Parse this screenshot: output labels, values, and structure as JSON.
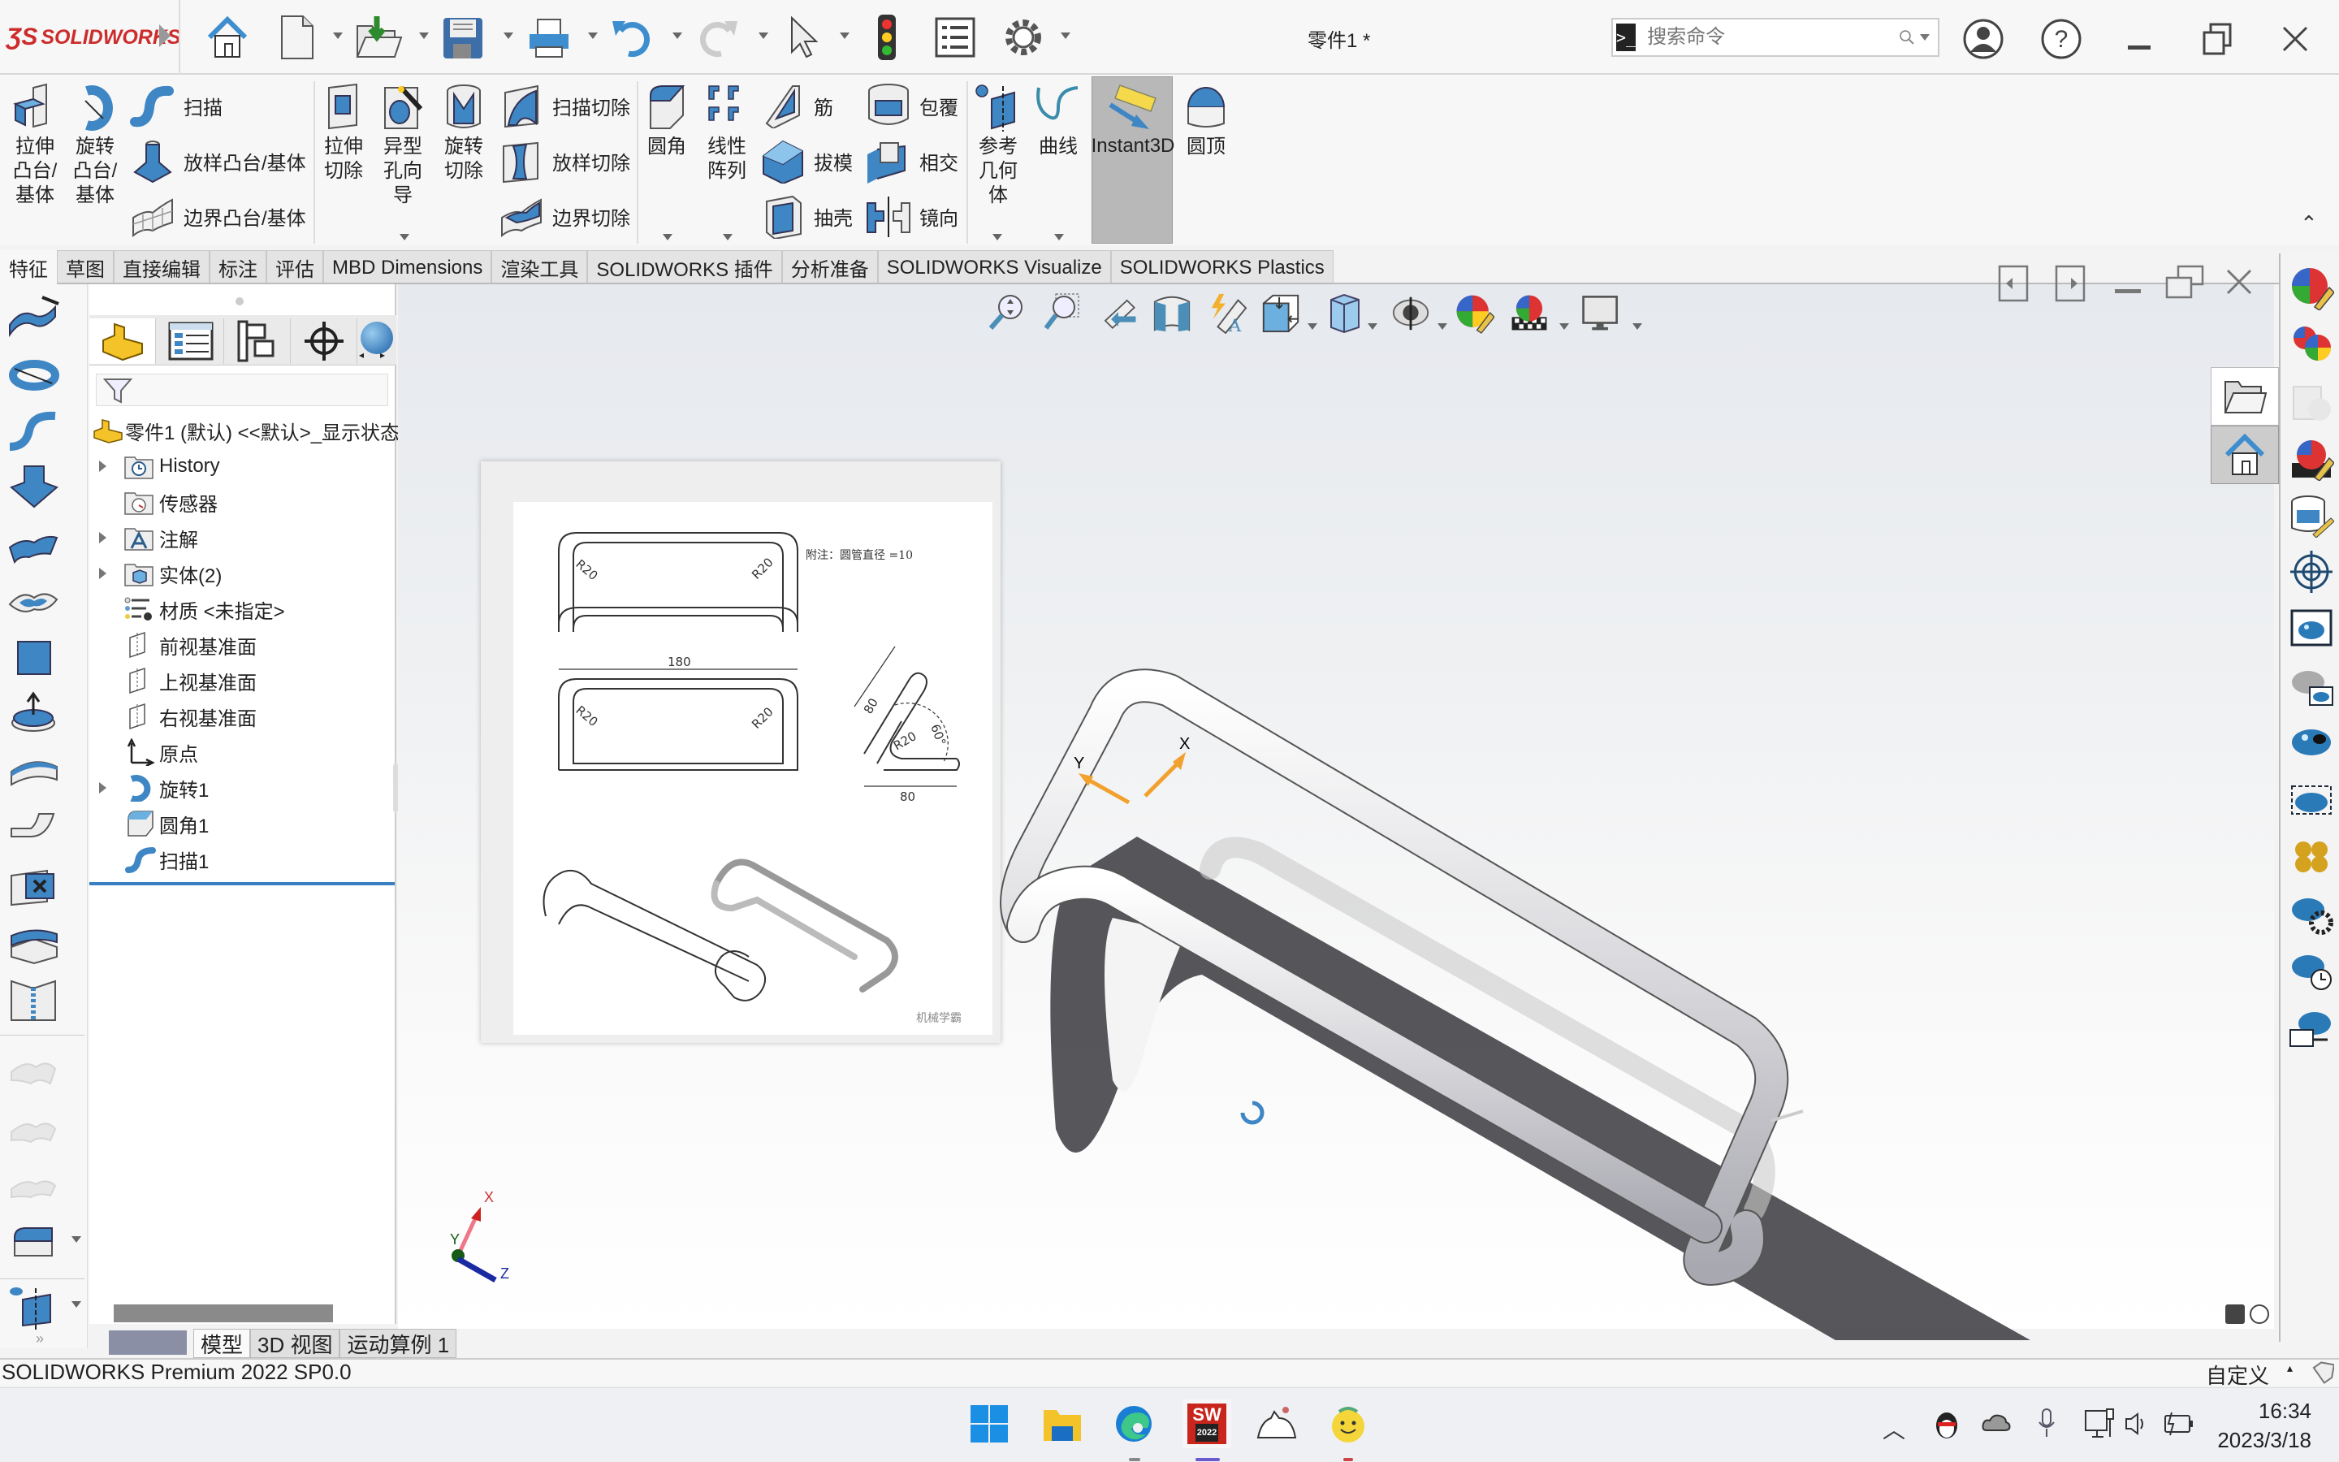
{
  "app": {
    "brand": "SOLIDWORKS",
    "document_title": "零件1 *",
    "search_placeholder": "搜索命令"
  },
  "quick_access": [
    {
      "icon": "home-icon"
    },
    {
      "icon": "new-document-icon"
    },
    {
      "icon": "open-icon"
    },
    {
      "icon": "save-icon"
    },
    {
      "icon": "print-icon"
    },
    {
      "icon": "undo-icon"
    },
    {
      "icon": "redo-icon"
    },
    {
      "icon": "select-icon"
    },
    {
      "icon": "rebuild-traffic-light-icon"
    },
    {
      "icon": "file-properties-icon"
    },
    {
      "icon": "options-gear-icon"
    }
  ],
  "ribbon": {
    "extrude_boss": "拉伸\n凸台/\n基体",
    "revolve_boss": "旋转\n凸台/\n基体",
    "sweep": "扫描",
    "loft_boss": "放样凸台/基体",
    "boundary_boss": "边界凸台/基体",
    "extrude_cut": "拉伸\n切除",
    "hole_wizard": "异型\n孔向\n导",
    "revolve_cut": "旋转\n切除",
    "sweep_cut": "扫描切除",
    "loft_cut": "放样切除",
    "boundary_cut": "边界切除",
    "fillet": "圆角",
    "linear_pattern": "线性\n阵列",
    "rib": "筋",
    "draft": "拔模",
    "shell": "抽壳",
    "wrap": "包覆",
    "intersect": "相交",
    "mirror": "镜向",
    "ref_geometry": "参考\n几何\n体",
    "curves": "曲线",
    "instant3d": "Instant3D",
    "dome": "圆顶"
  },
  "tabs": [
    {
      "label": "特征",
      "active": true
    },
    {
      "label": "草图"
    },
    {
      "label": "直接编辑"
    },
    {
      "label": "标注"
    },
    {
      "label": "评估"
    },
    {
      "label": "MBD Dimensions"
    },
    {
      "label": "渲染工具"
    },
    {
      "label": "SOLIDWORKS 插件"
    },
    {
      "label": "分析准备"
    },
    {
      "label": "SOLIDWORKS Visualize"
    },
    {
      "label": "SOLIDWORKS Plastics"
    }
  ],
  "feature_tree": {
    "root": "零件1 (默认) <<默认>_显示状态",
    "items": [
      {
        "label": "History",
        "expandable": true,
        "icon": "history-folder-icon"
      },
      {
        "label": "传感器",
        "expandable": false,
        "icon": "sensors-folder-icon"
      },
      {
        "label": "注解",
        "expandable": true,
        "icon": "annotations-folder-icon"
      },
      {
        "label": "实体(2)",
        "expandable": true,
        "icon": "solid-bodies-folder-icon"
      },
      {
        "label": "材质 <未指定>",
        "expandable": false,
        "icon": "material-icon"
      },
      {
        "label": "前视基准面",
        "expandable": false,
        "icon": "plane-icon"
      },
      {
        "label": "上视基准面",
        "expandable": false,
        "icon": "plane-icon"
      },
      {
        "label": "右视基准面",
        "expandable": false,
        "icon": "plane-icon"
      },
      {
        "label": "原点",
        "expandable": false,
        "icon": "origin-icon"
      },
      {
        "label": "旋转1",
        "expandable": true,
        "icon": "revolve-feature-icon"
      },
      {
        "label": "圆角1",
        "expandable": false,
        "icon": "fillet-feature-icon"
      },
      {
        "label": "扫描1",
        "expandable": false,
        "icon": "sweep-feature-icon"
      }
    ]
  },
  "reference_drawing": {
    "note": "附注：圆管直径 =10",
    "dims": {
      "width": "180",
      "radius": "R20",
      "leg1": "80",
      "leg2": "80",
      "angle": "60°"
    },
    "watermark": "机械学霸"
  },
  "viewport": {
    "triad_x": "X",
    "triad_y": "Y",
    "triad_z": "Z",
    "drag_x": "X",
    "drag_y": "Y"
  },
  "bottom_tabs": [
    {
      "label": "模型",
      "active": true
    },
    {
      "label": "3D 视图"
    },
    {
      "label": "运动算例 1"
    }
  ],
  "status": {
    "version": "SOLIDWORKS Premium 2022 SP0.0",
    "units": "自定义"
  },
  "taskbar": {
    "time": "16:34",
    "date": "2023/3/18",
    "sw_badge": "2022"
  }
}
